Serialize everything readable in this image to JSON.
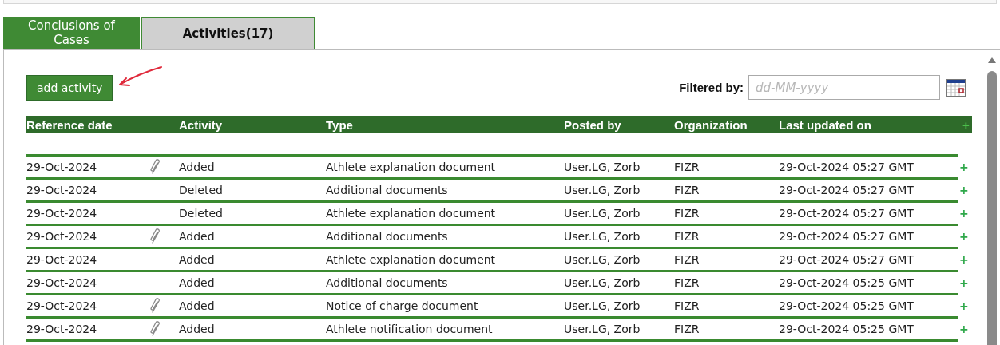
{
  "tabs": [
    {
      "label": "Conclusions of Cases",
      "selected": false
    },
    {
      "label": "Activities(17)",
      "selected": true
    }
  ],
  "add_button": "add activity",
  "filter": {
    "label": "Filtered by:",
    "placeholder": "dd-MM-yyyy"
  },
  "table": {
    "columns": [
      "Reference date",
      "Activity",
      "Type",
      "Posted by",
      "Organization",
      "Last updated on"
    ],
    "header_action": "+",
    "rows": [
      {
        "reference_date": "29-Oct-2024",
        "attachment": true,
        "activity": "Added",
        "type": "Athlete explanation document",
        "posted_by": "User.LG, Zorb",
        "organization": "FIZR",
        "last_updated_on": "29-Oct-2024 05:27 GMT",
        "action": "+"
      },
      {
        "reference_date": "29-Oct-2024",
        "attachment": false,
        "activity": "Deleted",
        "type": "Additional documents",
        "posted_by": "User.LG, Zorb",
        "organization": "FIZR",
        "last_updated_on": "29-Oct-2024 05:27 GMT",
        "action": "+"
      },
      {
        "reference_date": "29-Oct-2024",
        "attachment": false,
        "activity": "Deleted",
        "type": "Athlete explanation document",
        "posted_by": "User.LG, Zorb",
        "organization": "FIZR",
        "last_updated_on": "29-Oct-2024 05:27 GMT",
        "action": "+"
      },
      {
        "reference_date": "29-Oct-2024",
        "attachment": true,
        "activity": "Added",
        "type": "Additional documents",
        "posted_by": "User.LG, Zorb",
        "organization": "FIZR",
        "last_updated_on": "29-Oct-2024 05:27 GMT",
        "action": "+"
      },
      {
        "reference_date": "29-Oct-2024",
        "attachment": false,
        "activity": "Added",
        "type": "Athlete explanation document",
        "posted_by": "User.LG, Zorb",
        "organization": "FIZR",
        "last_updated_on": "29-Oct-2024 05:27 GMT",
        "action": "+"
      },
      {
        "reference_date": "29-Oct-2024",
        "attachment": false,
        "activity": "Added",
        "type": "Additional documents",
        "posted_by": "User.LG, Zorb",
        "organization": "FIZR",
        "last_updated_on": "29-Oct-2024 05:25 GMT",
        "action": "+"
      },
      {
        "reference_date": "29-Oct-2024",
        "attachment": true,
        "activity": "Added",
        "type": "Notice of charge document",
        "posted_by": "User.LG, Zorb",
        "organization": "FIZR",
        "last_updated_on": "29-Oct-2024 05:25 GMT",
        "action": "+"
      },
      {
        "reference_date": "29-Oct-2024",
        "attachment": true,
        "activity": "Added",
        "type": "Athlete notification document",
        "posted_by": "User.LG, Zorb",
        "organization": "FIZR",
        "last_updated_on": "29-Oct-2024 05:25 GMT",
        "action": "+"
      }
    ]
  }
}
